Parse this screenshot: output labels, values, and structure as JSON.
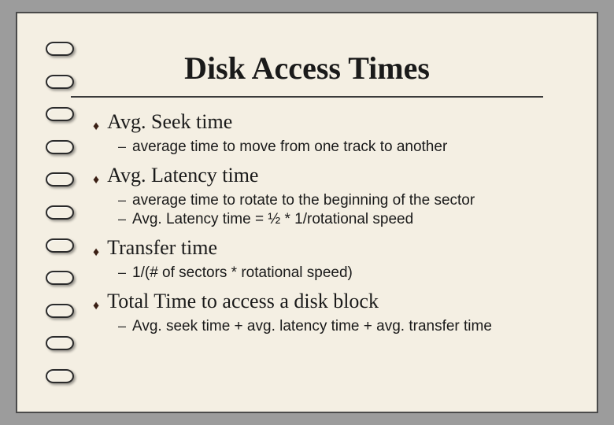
{
  "title": "Disk Access Times",
  "items": [
    {
      "label": "Avg. Seek time",
      "subs": [
        "average time to move from one track to another"
      ]
    },
    {
      "label": "Avg. Latency time",
      "subs": [
        "average time to rotate to the beginning of the sector",
        "Avg. Latency time = ½ * 1/rotational speed"
      ]
    },
    {
      "label": "Transfer time",
      "subs": [
        "1/(# of sectors * rotational speed)"
      ]
    },
    {
      "label": "Total Time to access a disk block",
      "subs": [
        "Avg. seek time + avg. latency time + avg. transfer time"
      ]
    }
  ]
}
